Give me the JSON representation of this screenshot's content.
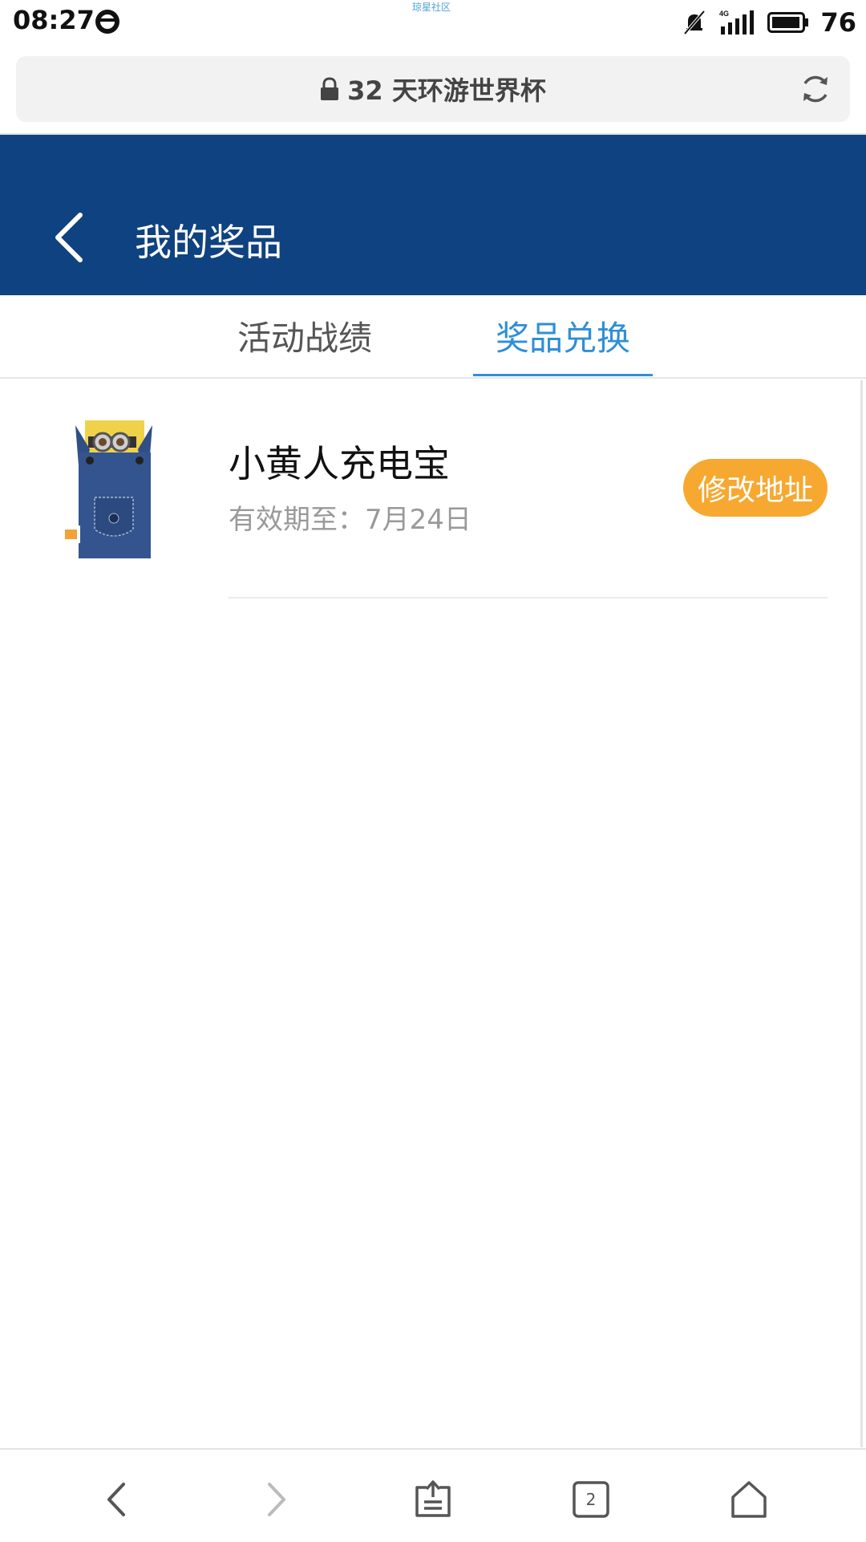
{
  "status_bar": {
    "time": "08:27",
    "watermark": "琼星社区",
    "network": "4G",
    "battery": "76"
  },
  "browser": {
    "page_title": "32 天环游世界杯",
    "open_tabs": "2"
  },
  "header": {
    "title": "我的奖品"
  },
  "tabs": [
    {
      "label": "活动战绩",
      "active": false
    },
    {
      "label": "奖品兑换",
      "active": true
    }
  ],
  "prizes": [
    {
      "name": "小黄人充电宝",
      "expiry": "有效期至：7月24日",
      "action_label": "修改地址"
    }
  ],
  "colors": {
    "header_bg": "#0f4281",
    "active_tab": "#2f8fd6",
    "action_button": "#f7a830"
  }
}
